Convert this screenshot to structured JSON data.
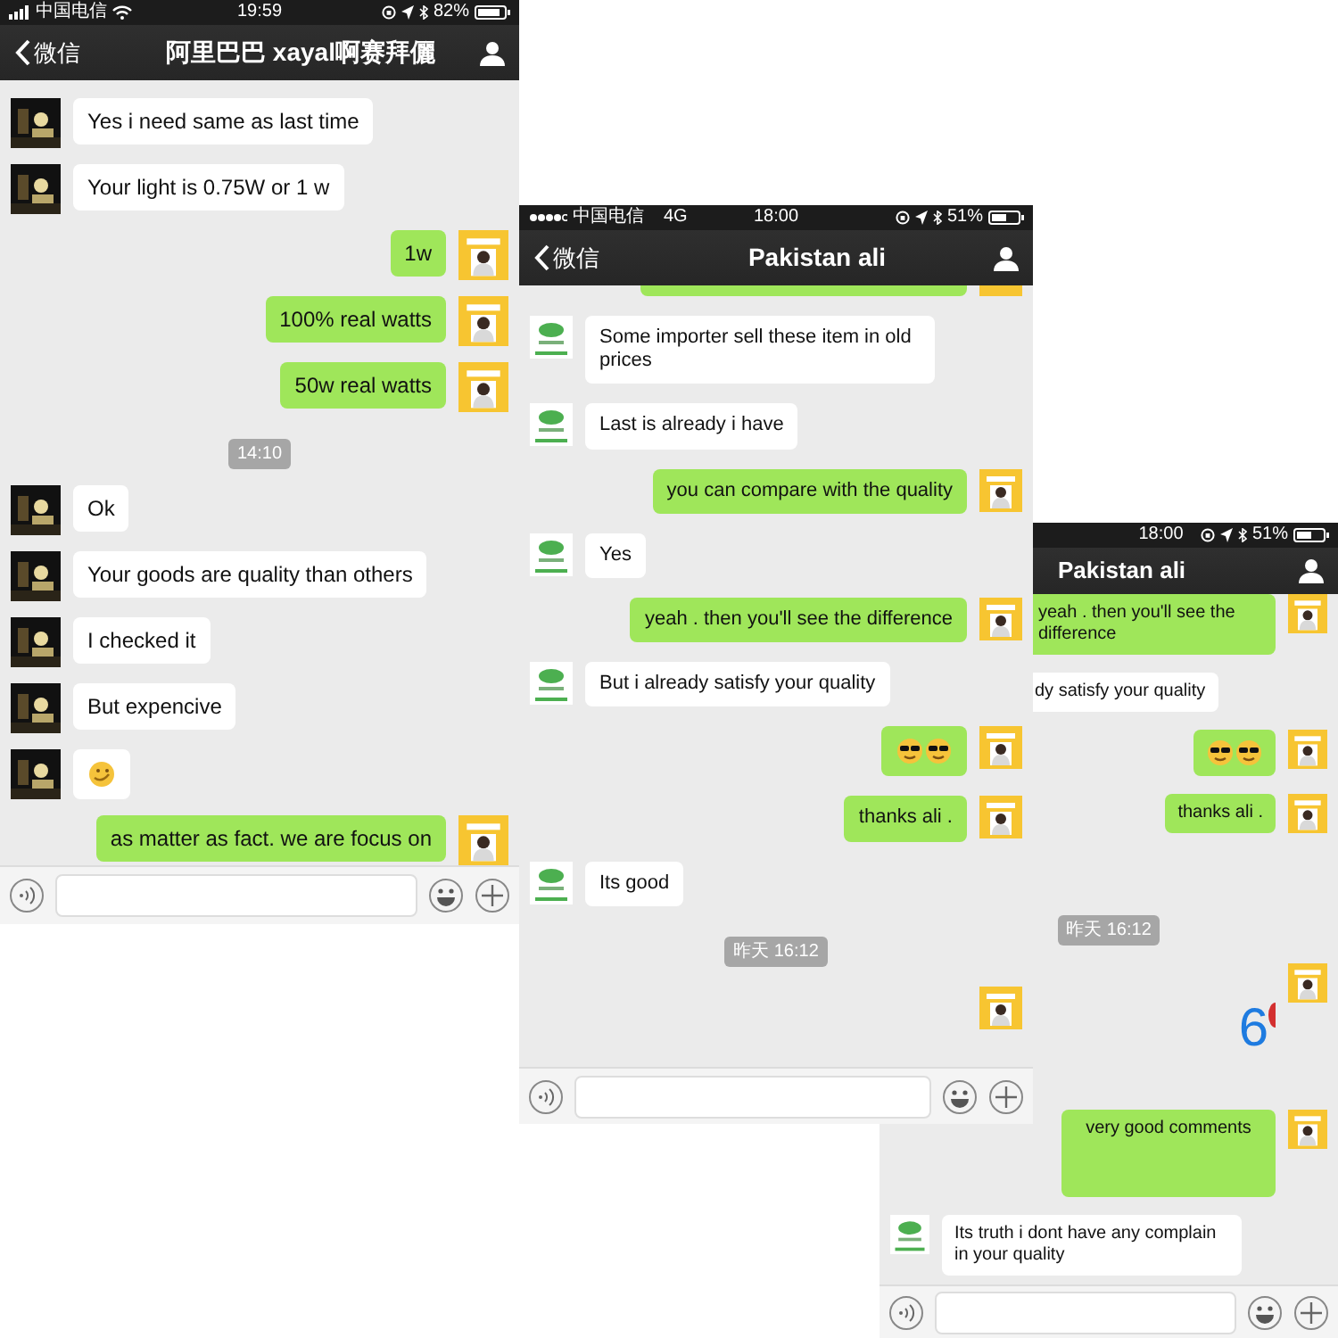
{
  "panels": [
    {
      "status_bar": {
        "carrier": "中国电信",
        "wifi": true,
        "time": "19:59",
        "battery": "82%"
      },
      "nav": {
        "back": "微信",
        "title": "阿里巴巴 xayal啊赛拜儷"
      },
      "messages": [
        {
          "outgoing": false,
          "kind": "text",
          "text": "Yes i need same as last time"
        },
        {
          "outgoing": false,
          "kind": "text",
          "text": "Your light is  0.75W or 1 w"
        },
        {
          "outgoing": true,
          "kind": "text",
          "text": "1w"
        },
        {
          "outgoing": true,
          "kind": "text",
          "text": "100% real watts"
        },
        {
          "outgoing": true,
          "kind": "text",
          "text": "50w real watts"
        },
        {
          "kind": "time",
          "text": "14:10"
        },
        {
          "outgoing": false,
          "kind": "text",
          "text": "Ok"
        },
        {
          "outgoing": false,
          "kind": "text",
          "text": "Your goods are quality than others"
        },
        {
          "outgoing": false,
          "kind": "text",
          "text": "I checked it"
        },
        {
          "outgoing": false,
          "kind": "text",
          "text": "But expencive"
        },
        {
          "outgoing": false,
          "kind": "smirk"
        },
        {
          "outgoing": true,
          "kind": "text",
          "text": "as matter as fact. we are focus on"
        }
      ]
    },
    {
      "contact_avatar": {
        "kind": "logo"
      },
      "status_bar": {
        "carrier": "中国电信",
        "network": "4G",
        "time": "18:00",
        "battery": "51%"
      },
      "nav": {
        "back": "微信",
        "title": "Pakistan ali"
      },
      "messages": [
        {
          "outgoing": true,
          "kind": "stub"
        },
        {
          "outgoing": false,
          "kind": "text",
          "text": "Some importer sell these item in old prices"
        },
        {
          "outgoing": false,
          "kind": "text",
          "text": "Last is already i have"
        },
        {
          "outgoing": true,
          "kind": "text",
          "text": "you can compare with the quality"
        },
        {
          "outgoing": false,
          "kind": "text",
          "text": "Yes"
        },
        {
          "outgoing": true,
          "kind": "text",
          "text": "yeah . then you'll see the difference"
        },
        {
          "outgoing": false,
          "kind": "text",
          "text": "But i already satisfy your quality"
        },
        {
          "outgoing": true,
          "kind": "sunglasses"
        },
        {
          "outgoing": true,
          "kind": "text",
          "text": "thanks  ali ."
        },
        {
          "outgoing": false,
          "kind": "text",
          "text": "Its good"
        },
        {
          "kind": "time",
          "text": "昨天 16:12"
        },
        {
          "outgoing": true,
          "kind": "avatar"
        }
      ]
    },
    {
      "contact_avatar": {
        "kind": "logo"
      },
      "status_bar": {
        "time": "18:00",
        "battery": "51%"
      },
      "nav": {
        "title": "Pakistan ali"
      },
      "messages": [
        {
          "outgoing": true,
          "kind": "text",
          "text": "yeah . then you'll see the difference"
        },
        {
          "outgoing": false,
          "kind": "clipped",
          "text": "dy satisfy your quality"
        },
        {
          "outgoing": true,
          "kind": "sunglasses"
        },
        {
          "outgoing": true,
          "kind": "text",
          "text": "thanks  ali ."
        },
        {
          "kind": "time",
          "text": "昨天 16:12"
        },
        {
          "outgoing": true,
          "kind": "sticker",
          "text": "6"
        },
        {
          "outgoing": true,
          "kind": "tall",
          "text": "very good  comments"
        },
        {
          "outgoing": false,
          "kind": "text",
          "text": "Its truth i dont have any complain in your quality"
        }
      ]
    }
  ]
}
